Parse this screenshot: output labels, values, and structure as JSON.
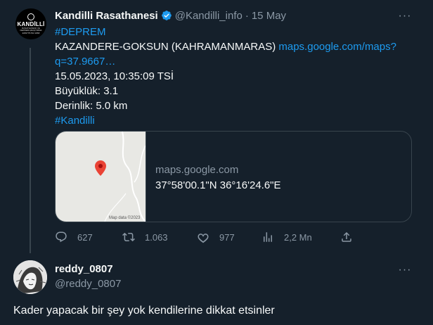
{
  "tweet": {
    "author_name": "Kandilli Rasathanesi",
    "author_handle": "@Kandilli_info",
    "separator": "·",
    "date": "15 May",
    "avatar_logo_text": "KANDİLLİ",
    "avatar_logo_sub": "RASATHANESİ VE DEPREM ARAŞTIRMA ENSTİTÜSÜ 1868",
    "hashtag1": "#DEPREM",
    "location_text": "KAZANDERE-GOKSUN (KAHRAMANMARAS)",
    "link_part1": "maps.google.com/maps?",
    "link_part2": "q=37.9667…",
    "datetime_line": "15.05.2023, 10:35:09 TSİ",
    "magnitude_line": "Büyüklük: 3.1",
    "depth_line": "Derinlik: 5.0 km",
    "hashtag2": "#Kandilli",
    "card": {
      "domain": "maps.google.com",
      "title": "37°58'00.1\"N 36°16'24.6\"E",
      "map_credit": "Map data ©2023"
    },
    "actions": {
      "replies": "627",
      "retweets": "1.063",
      "likes": "977",
      "views": "2,2 Mn"
    }
  },
  "reply": {
    "author_name": "reddy_0807",
    "author_handle": "@reddy_0807",
    "text": "Kader yapacak bir şey yok kendilerine dikkat etsinler"
  },
  "more_icon": "···",
  "colors": {
    "background": "#15202b",
    "link": "#1d9bf0",
    "muted": "#8b98a5",
    "border": "#38444d",
    "verified": "#1d9bf0",
    "pin": "#ea4335"
  }
}
